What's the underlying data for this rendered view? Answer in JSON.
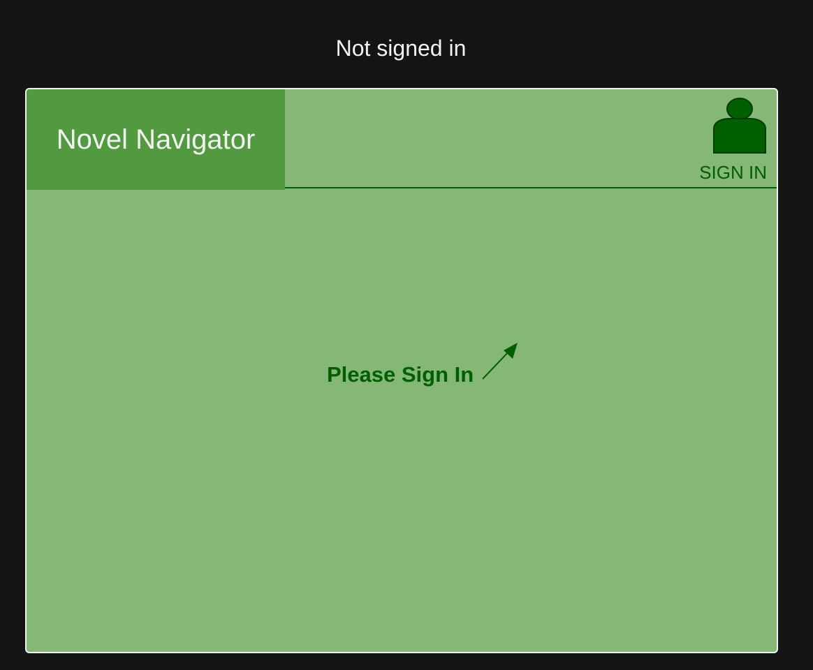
{
  "page": {
    "caption": "Not signed in"
  },
  "app": {
    "title": "Novel Navigator",
    "sign_in": {
      "label": "SIGN IN",
      "icon": "user-icon"
    },
    "main": {
      "prompt": "Please Sign In",
      "pointer_icon": "arrow-up-right-icon"
    }
  },
  "colors": {
    "page_background": "#141414",
    "app_background": "#85b776",
    "brand_background": "#519a3f",
    "accent_green": "#006000",
    "light_text": "#f2f2f2"
  }
}
